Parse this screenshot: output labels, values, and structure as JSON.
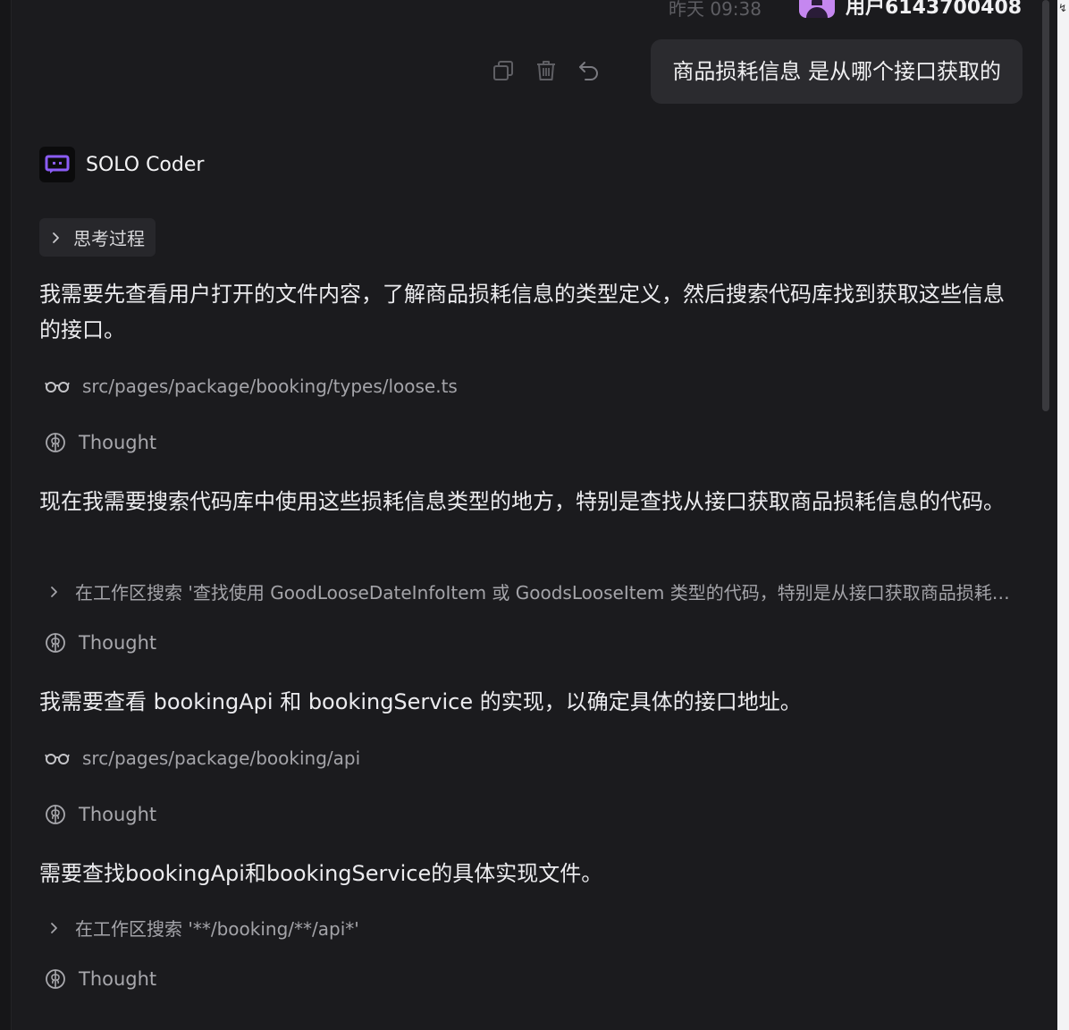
{
  "header": {
    "timestamp": "昨天 09:38",
    "username": "用户6143700408",
    "avatar_color": "#c587f0"
  },
  "user_message": {
    "text": "商品损耗信息 是从哪个接口获取的",
    "actions": [
      "copy-icon",
      "trash-icon",
      "undo-icon"
    ]
  },
  "agent": {
    "name": "SOLO Coder",
    "logo_accent": "#8b5cf6"
  },
  "thinking_chip": {
    "label": "思考过程"
  },
  "steps": {
    "p1": "我需要先查看用户打开的文件内容，了解商品损耗信息的类型定义，然后搜索代码库找到获取这些信息的接口。",
    "f1": "src/pages/package/booking/types/loose.ts",
    "t1": "Thought",
    "p2": "现在我需要搜索代码库中使用这些损耗信息类型的地方，特别是查找从接口获取商品损耗信息的代码。",
    "s1": "在工作区搜索 '查找使用 GoodLooseDateInfoItem 或 GoodsLooseItem 类型的代码，特别是从接口获取商品损耗信息的代码'",
    "t2": "Thought",
    "p3": "我需要查看 bookingApi 和 bookingService 的实现，以确定具体的接口地址。",
    "f2": "src/pages/package/booking/api",
    "t3": "Thought",
    "p4": "需要查找bookingApi和bookingService的具体实现文件。",
    "s2": "在工作区搜索 '**/booking/**/api*'",
    "t4": "Thought"
  }
}
